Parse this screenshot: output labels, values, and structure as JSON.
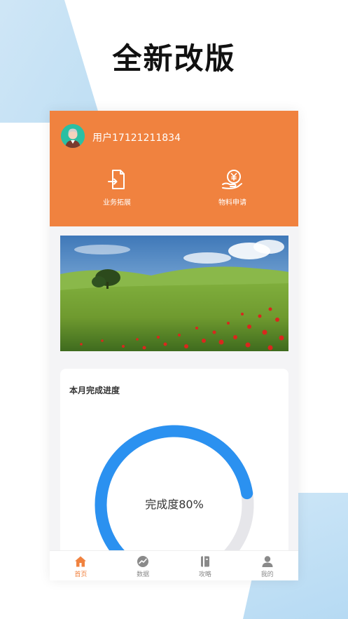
{
  "headline": "全新改版",
  "user": {
    "name": "用户17121211834"
  },
  "quick_actions": [
    {
      "label": "业务拓展",
      "icon": "document-transfer-icon"
    },
    {
      "label": "物料申请",
      "icon": "yuan-hand-icon"
    }
  ],
  "banner": {
    "description_icon": "landscape-field-image"
  },
  "progress_card": {
    "title": "本月完成进度",
    "text": "完成度80%",
    "progress": 0.8,
    "colors": {
      "fill": "#2b91f0",
      "track": "#e6e6ea"
    }
  },
  "tabbar": {
    "items": [
      {
        "label": "首页",
        "icon": "home-icon",
        "active": true
      },
      {
        "label": "数据",
        "icon": "trend-icon",
        "active": false
      },
      {
        "label": "攻略",
        "icon": "book-icon",
        "active": false
      },
      {
        "label": "我的",
        "icon": "person-icon",
        "active": false
      }
    ]
  },
  "colors": {
    "brand": "#f0823f",
    "accent": "#2b91f0",
    "background": "#f4f4f6"
  }
}
